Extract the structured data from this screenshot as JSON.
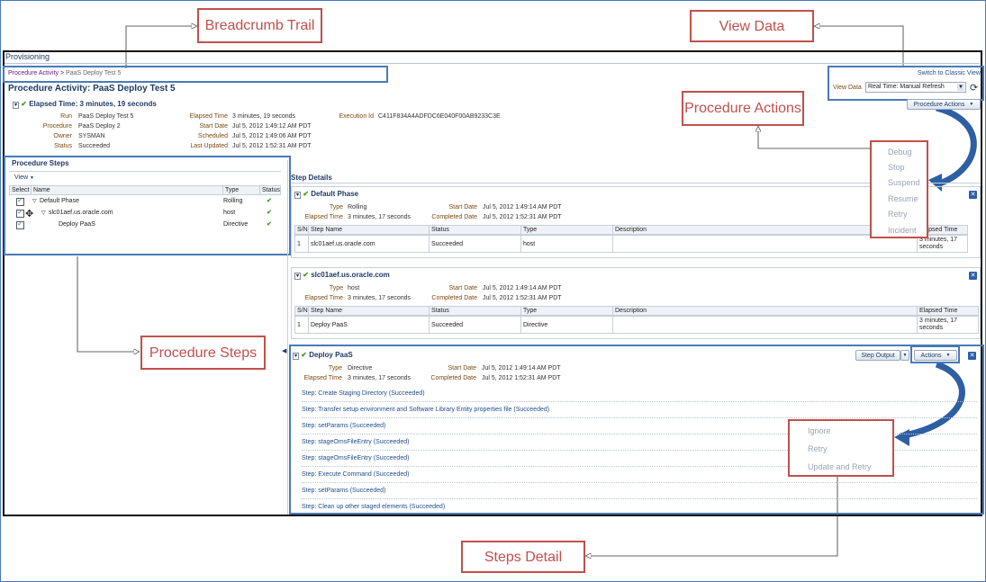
{
  "callouts": {
    "breadcrumb_trail": "Breadcrumb Trail",
    "view_data": "View Data",
    "procedure_actions": "Procedure Actions",
    "procedure_steps": "Procedure Steps",
    "steps_detail": "Steps Detail"
  },
  "app": {
    "title": "Provisioning",
    "breadcrumb": {
      "parent": "Procedure Activity",
      "sep": ">",
      "current": "PaaS Deploy Test 5"
    },
    "page_title": "Procedure Activity: PaaS Deploy Test 5",
    "switch_view": "Switch to Classic View",
    "view_data_label": "View Data",
    "view_data_value": "Real Time: Manual Refresh",
    "procedure_actions_button": "Procedure Actions"
  },
  "summary": {
    "elapsed_heading": "Elapsed Time: 3 minutes, 19 seconds",
    "run_label": "Run",
    "run": "PaaS Deploy Test 5",
    "procedure_label": "Procedure",
    "procedure": "PaaS Deploy 2",
    "owner_label": "Owner",
    "owner": "SYSMAN",
    "status_label": "Status",
    "status": "Succeeded",
    "elapsed_label": "Elapsed Time",
    "elapsed": "3 minutes, 19 seconds",
    "start_label": "Start Date",
    "start": "Jul 5, 2012 1:49:12 AM PDT",
    "scheduled_label": "Scheduled",
    "scheduled": "Jul 5, 2012 1:49:06 AM PDT",
    "updated_label": "Last Updated",
    "updated": "Jul 5, 2012 1:52:31 AM PDT",
    "exec_label": "Execution Id",
    "exec": "C411F834A4ADFDC6E040F00AB9233C3E"
  },
  "procedure_steps": {
    "title": "Procedure Steps",
    "view_menu": "View",
    "headers": [
      "Select",
      "Name",
      "Type",
      "Status"
    ],
    "rows": [
      {
        "name": "Default Phase",
        "type": "Rolling"
      },
      {
        "name": "slc01aef.us.oracle.com",
        "type": "host"
      },
      {
        "name": "Deploy PaaS",
        "type": "Directive"
      }
    ]
  },
  "step_details": {
    "title": "Step Details",
    "type_label": "Type",
    "elapsed_label": "Elapsed Time",
    "start_label": "Start Date",
    "completed_label": "Completed Date",
    "headers": [
      "S/N",
      "Step Name",
      "Status",
      "Type",
      "Description",
      "Elapsed Time"
    ],
    "phase": {
      "name": "Default Phase",
      "type": "Rolling",
      "elapsed": "3 minutes, 17 seconds",
      "start": "Jul 5, 2012 1:49:14 AM PDT",
      "completed": "Jul 5, 2012 1:52:31 AM PDT",
      "row": {
        "sn": "1",
        "name": "slc01aef.us.oracle.com",
        "status": "Succeeded",
        "type": "host",
        "desc": "",
        "elapsed": "3 minutes, 17 seconds"
      }
    },
    "host": {
      "name": "slc01aef.us.oracle.com",
      "type": "host",
      "elapsed": "3 minutes, 17 seconds",
      "start": "Jul 5, 2012 1:49:14 AM PDT",
      "completed": "Jul 5, 2012 1:52:31 AM PDT",
      "row": {
        "sn": "1",
        "name": "Deploy PaaS",
        "status": "Succeeded",
        "type": "Directive",
        "desc": "",
        "elapsed": "3 minutes, 17 seconds"
      }
    },
    "directive": {
      "name": "Deploy PaaS",
      "type": "Directive",
      "elapsed": "3 minutes, 17 seconds",
      "start": "Jul 5, 2012 1:49:14 AM PDT",
      "completed": "Jul 5, 2012 1:52:31 AM PDT",
      "step_output_button": "Step Output",
      "actions_button": "Actions",
      "steps": [
        "Step: Create Staging Directory (Succeeded)",
        "Step: Transfer setup environment and Software Library Entity properties file (Succeeded)",
        "Step: setParams (Succeeded)",
        "Step: stageOmsFileEntry (Succeeded)",
        "Step: stageOmsFileEntry (Succeeded)",
        "Step: Execute Command (Succeeded)",
        "Step: setParams (Succeeded)",
        "Step: Clean up other staged elements (Succeeded)"
      ]
    }
  },
  "procedure_actions_menu": [
    "Debug",
    "Stop",
    "Suspend",
    "Resume",
    "Retry",
    "Incident"
  ],
  "step_actions_menu": [
    "Ignore",
    "Retry",
    "Update and Retry"
  ]
}
